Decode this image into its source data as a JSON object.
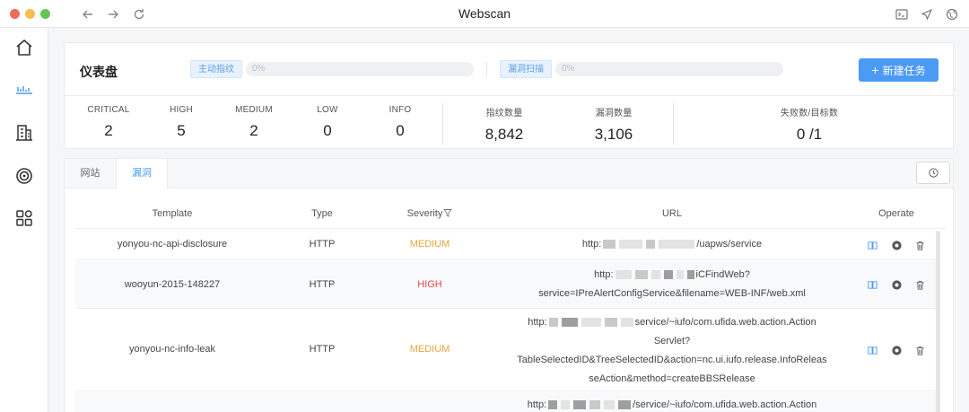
{
  "window": {
    "title": "Webscan"
  },
  "dashboard": {
    "title": "仪表盘",
    "fingerprint_tag": "主动指纹",
    "fingerprint_progress": "0%",
    "vuln_tag": "漏洞扫描",
    "vuln_progress": "0%",
    "new_task_label": "新建任务",
    "stats": [
      {
        "label": "CRITICAL",
        "value": "2"
      },
      {
        "label": "HIGH",
        "value": "5"
      },
      {
        "label": "MEDIUM",
        "value": "2"
      },
      {
        "label": "LOW",
        "value": "0"
      },
      {
        "label": "INFO",
        "value": "0"
      },
      {
        "label": "指纹数量",
        "value": "8,842"
      },
      {
        "label": "漏洞数量",
        "value": "3,106"
      },
      {
        "label": "失败数/目标数",
        "value": "0 /1"
      }
    ]
  },
  "tabs": {
    "site": "网站",
    "vuln": "漏洞"
  },
  "table": {
    "columns": {
      "template": "Template",
      "type": "Type",
      "severity": "Severity",
      "url": "URL",
      "operate": "Operate"
    },
    "rows": [
      {
        "template": "yonyou-nc-api-disclosure",
        "type": "HTTP",
        "severity": "MEDIUM",
        "url": {
          "prefix": "http:",
          "suffix": "/uapws/service"
        }
      },
      {
        "template": "wooyun-2015-148227",
        "type": "HTTP",
        "severity": "HIGH",
        "url": {
          "prefix": "http:",
          "suffix": "iCFindWeb?",
          "line2": "service=IPreAlertConfigService&filename=WEB-INF/web.xml"
        }
      },
      {
        "template": "yonyou-nc-info-leak",
        "type": "HTTP",
        "severity": "MEDIUM",
        "url": {
          "prefix": "http:",
          "suffix": "service/~iufo/com.ufida.web.action.Action",
          "line2": "Servlet?",
          "line3": "TableSelectedID&TreeSelectedID&action=nc.ui.iufo.release.InfoReleas",
          "line4": "seAction&method=createBBSRelease"
        }
      },
      {
        "template": "",
        "type": "",
        "severity": "",
        "url": {
          "prefix": "http:",
          "suffix": "/service/~iufo/com.ufida.web.action.Action"
        }
      }
    ]
  },
  "colors": {
    "accent": "#4b9af4",
    "medium": "#e5a53a",
    "high": "#e5484d"
  },
  "icons": [
    "back-icon",
    "forward-icon",
    "reload-icon",
    "terminal-icon",
    "send-icon",
    "globe-icon",
    "home-icon",
    "dashboard-icon",
    "building-icon",
    "target-icon",
    "apps-icon",
    "history-icon",
    "book-icon",
    "chrome-icon",
    "trash-icon",
    "filter-icon",
    "plus-icon"
  ]
}
